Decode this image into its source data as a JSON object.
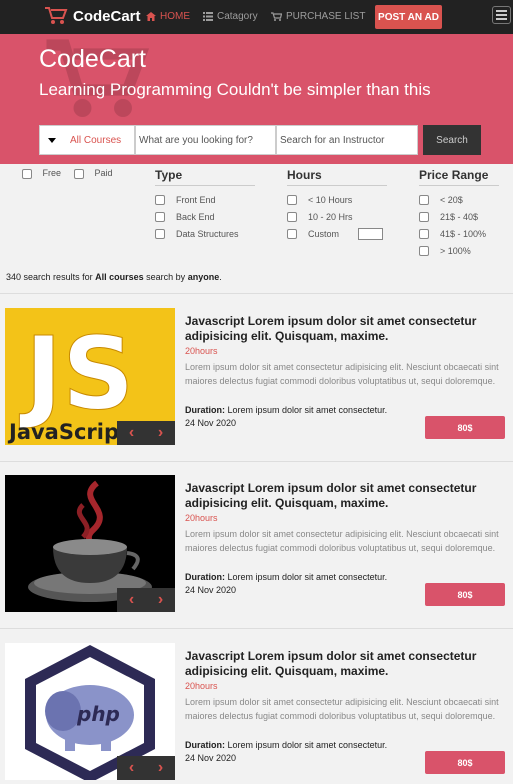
{
  "navbar": {
    "brand": "CodeCart",
    "links": [
      {
        "label": "HOME",
        "icon": "home-icon",
        "active": true
      },
      {
        "label": "Catagory",
        "icon": "list-icon",
        "active": false
      },
      {
        "label": "PURCHASE LIST",
        "icon": "cart-icon",
        "active": false
      }
    ],
    "post_ad": "POST AN AD"
  },
  "hero": {
    "title": "CodeCart",
    "subtitle": "Learning Programming Couldn't be simpler than this",
    "select_value": "All Courses",
    "search_placeholder": "What are you looking for?",
    "instructor_placeholder": "Search for an Instructor",
    "search_button": "Search"
  },
  "filters": {
    "free": "Free",
    "paid": "Paid",
    "type": {
      "heading": "Type",
      "options": [
        "Front End",
        "Back End",
        "Data Structures"
      ]
    },
    "hours": {
      "heading": "Hours",
      "options": [
        "< 10 Hours",
        "10 - 20 Hrs",
        "Custom"
      ]
    },
    "price": {
      "heading": "Price Range",
      "options": [
        "< 20$",
        "21$ - 40$",
        "41$ - 100%",
        "> 100%"
      ]
    }
  },
  "results": {
    "count": "340",
    "prefix": "search results for",
    "category": "All courses",
    "mid": "search by",
    "by": "anyone",
    "suffix": "."
  },
  "courses": [
    {
      "image": "javascript-logo",
      "title": "Javascript Lorem ipsum dolor sit amet consectetur adipisicing elit. Quisquam, maxime.",
      "hours": "20hours",
      "description": "Lorem ipsum dolor sit amet consectetur adipisicing elit. Nesciunt obcaecati sint maiores delectus fugiat commodi doloribus voluptatibus ut, sequi doloremque.",
      "duration_label": "Duration:",
      "duration": "Lorem ipsum dolor sit amet consectetur.",
      "date": "24 Nov 2020",
      "price": "80$"
    },
    {
      "image": "java-logo",
      "title": "Javascript Lorem ipsum dolor sit amet consectetur adipisicing elit. Quisquam, maxime.",
      "hours": "20hours",
      "description": "Lorem ipsum dolor sit amet consectetur adipisicing elit. Nesciunt obcaecati sint maiores delectus fugiat commodi doloribus voluptatibus ut, sequi doloremque.",
      "duration_label": "Duration:",
      "duration": "Lorem ipsum dolor sit amet consectetur.",
      "date": "24 Nov 2020",
      "price": "80$"
    },
    {
      "image": "php-logo",
      "title": "Javascript Lorem ipsum dolor sit amet consectetur adipisicing elit. Quisquam, maxime.",
      "hours": "20hours",
      "description": "Lorem ipsum dolor sit amet consectetur adipisicing elit. Nesciunt obcaecati sint maiores delectus fugiat commodi doloribus voluptatibus ut, sequi doloremque.",
      "duration_label": "Duration:",
      "duration": "Lorem ipsum dolor sit amet consectetur.",
      "date": "24 Nov 2020",
      "price": "80$"
    }
  ],
  "carousel": {
    "prev": "‹",
    "next": "›"
  },
  "js_logo_text": "JS",
  "js_logo_word": "JavaScript",
  "colors": {
    "accent": "#d9534f",
    "hero": "#d9536a",
    "navbar": "#222222"
  }
}
